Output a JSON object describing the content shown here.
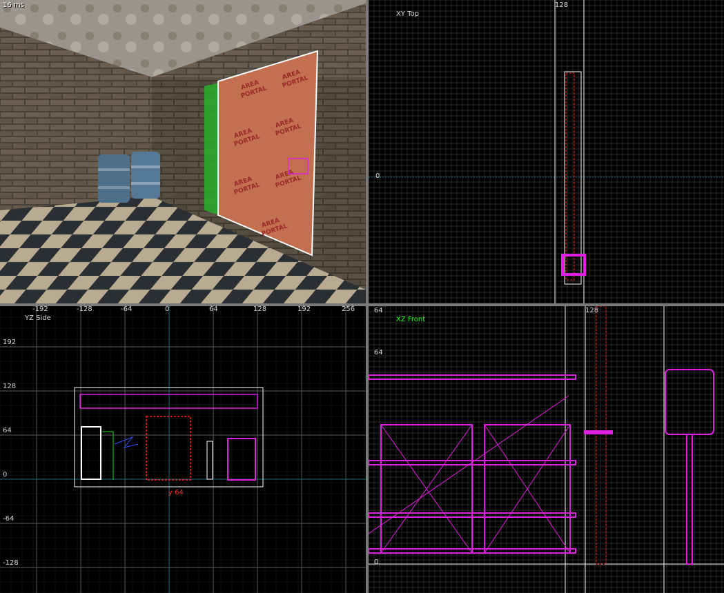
{
  "viewport_3d": {
    "title": "16 ms",
    "portal_text": [
      "AREA",
      "PORTAL"
    ]
  },
  "viewport_top": {
    "title": "XY Top",
    "ruler_x_label": "128",
    "ruler_y_label": "0"
  },
  "viewport_side": {
    "title": "YZ Side",
    "x_labels": [
      "-192",
      "-128",
      "-64",
      "0",
      "64",
      "128",
      "192",
      "256"
    ],
    "y_labels": [
      "192",
      "128",
      "64",
      "0",
      "-64",
      "-128"
    ],
    "size_label": "y 64"
  },
  "viewport_front": {
    "title": "XZ Front",
    "x_label": "128",
    "y_labels": [
      "64",
      "64",
      "0"
    ]
  },
  "colors": {
    "grid_minor": "#2a2a2a",
    "grid_major": "#5a5a5a",
    "selection": "#ff2020",
    "entity": "#e020e0",
    "white_line": "#ffffff",
    "axis": "#1a6a80"
  }
}
